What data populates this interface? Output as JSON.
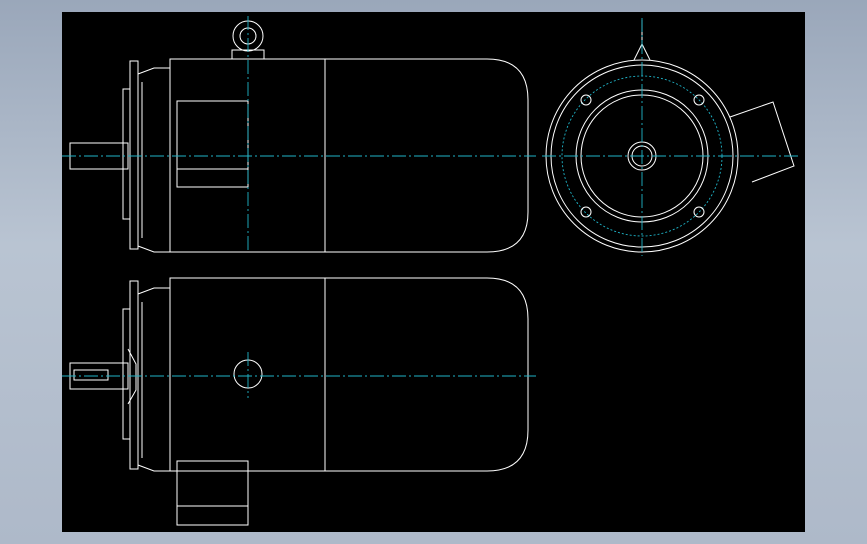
{
  "drawing": {
    "background_color": "#000000",
    "line_color": "#ffffff",
    "centerline_color": "#1fb5c9",
    "views": [
      "front-view",
      "end-view",
      "top-view"
    ]
  }
}
